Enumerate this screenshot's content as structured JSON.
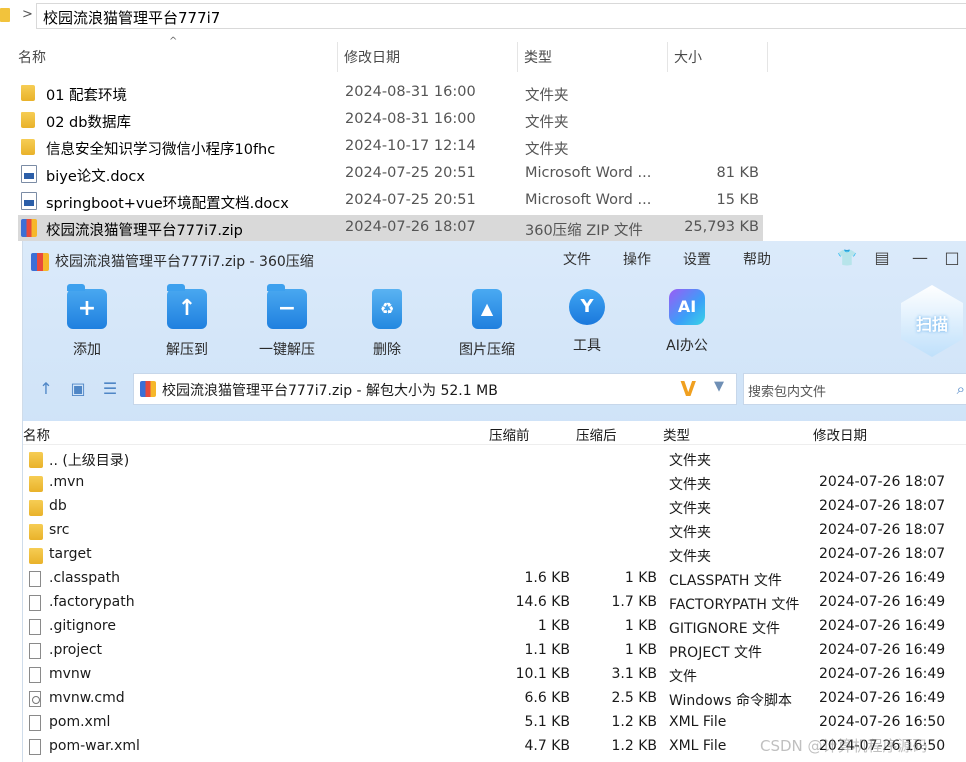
{
  "explorer": {
    "path": "校园流浪猫管理平台777i7",
    "columns": {
      "name": "名称",
      "date": "修改日期",
      "type": "类型",
      "size": "大小"
    },
    "rows": [
      {
        "name": "01 配套环境",
        "date": "2024-08-31 16:00",
        "type": "文件夹",
        "size": "",
        "icon": "folder-icon"
      },
      {
        "name": "02 db数据库",
        "date": "2024-08-31 16:00",
        "type": "文件夹",
        "size": "",
        "icon": "folder-icon"
      },
      {
        "name": "信息安全知识学习微信小程序10fhc",
        "date": "2024-10-17 12:14",
        "type": "文件夹",
        "size": "",
        "icon": "folder-icon"
      },
      {
        "name": "biye论文.docx",
        "date": "2024-07-25 20:51",
        "type": "Microsoft Word ...",
        "size": "81 KB",
        "icon": "word-doc-icon"
      },
      {
        "name": "springboot+vue环境配置文档.docx",
        "date": "2024-07-25 20:51",
        "type": "Microsoft Word ...",
        "size": "15 KB",
        "icon": "word-doc-icon"
      },
      {
        "name": "校园流浪猫管理平台777i7.zip",
        "date": "2024-07-26 18:07",
        "type": "360压缩 ZIP 文件",
        "size": "25,793 KB",
        "icon": "zip-icon"
      }
    ]
  },
  "zip": {
    "title": "校园流浪猫管理平台777i7.zip - 360压缩",
    "menu": [
      "文件",
      "操作",
      "设置",
      "帮助"
    ],
    "tools": [
      {
        "label": "添加",
        "icon": "add-icon"
      },
      {
        "label": "解压到",
        "icon": "extract-to-icon"
      },
      {
        "label": "一键解压",
        "icon": "one-click-extract-icon"
      },
      {
        "label": "删除",
        "icon": "delete-icon"
      },
      {
        "label": "图片压缩",
        "icon": "image-compress-icon"
      },
      {
        "label": "工具",
        "icon": "tools-icon"
      },
      {
        "label": "AI办公",
        "icon": "ai-office-icon"
      }
    ],
    "scan_label": "扫描",
    "path_text": "校园流浪猫管理平台777i7.zip - 解包大小为 52.1 MB",
    "search_placeholder": "搜索包内文件",
    "columns": {
      "name": "名称",
      "packed_before": "压缩前",
      "packed_after": "压缩后",
      "type": "类型",
      "date": "修改日期"
    },
    "rows": [
      {
        "name": ".. (上级目录)",
        "before": "",
        "after": "",
        "type": "文件夹",
        "date": "",
        "icon": "folder-icon"
      },
      {
        "name": ".mvn",
        "before": "",
        "after": "",
        "type": "文件夹",
        "date": "2024-07-26 18:07",
        "icon": "folder-icon"
      },
      {
        "name": "db",
        "before": "",
        "after": "",
        "type": "文件夹",
        "date": "2024-07-26 18:07",
        "icon": "folder-icon"
      },
      {
        "name": "src",
        "before": "",
        "after": "",
        "type": "文件夹",
        "date": "2024-07-26 18:07",
        "icon": "folder-icon"
      },
      {
        "name": "target",
        "before": "",
        "after": "",
        "type": "文件夹",
        "date": "2024-07-26 18:07",
        "icon": "folder-icon"
      },
      {
        "name": ".classpath",
        "before": "1.6 KB",
        "after": "1 KB",
        "type": "CLASSPATH 文件",
        "date": "2024-07-26 16:49",
        "icon": "file-icon"
      },
      {
        "name": ".factorypath",
        "before": "14.6 KB",
        "after": "1.7 KB",
        "type": "FACTORYPATH 文件",
        "date": "2024-07-26 16:49",
        "icon": "file-icon"
      },
      {
        "name": ".gitignore",
        "before": "1 KB",
        "after": "1 KB",
        "type": "GITIGNORE 文件",
        "date": "2024-07-26 16:49",
        "icon": "file-icon"
      },
      {
        "name": ".project",
        "before": "1.1 KB",
        "after": "1 KB",
        "type": "PROJECT 文件",
        "date": "2024-07-26 16:49",
        "icon": "file-icon"
      },
      {
        "name": "mvnw",
        "before": "10.1 KB",
        "after": "3.1 KB",
        "type": "文件",
        "date": "2024-07-26 16:49",
        "icon": "file-icon"
      },
      {
        "name": "mvnw.cmd",
        "before": "6.6 KB",
        "after": "2.5 KB",
        "type": "Windows 命令脚本",
        "date": "2024-07-26 16:49",
        "icon": "cmd-script-icon"
      },
      {
        "name": "pom.xml",
        "before": "5.1 KB",
        "after": "1.2 KB",
        "type": "XML File",
        "date": "2024-07-26 16:50",
        "icon": "file-icon"
      },
      {
        "name": "pom-war.xml",
        "before": "4.7 KB",
        "after": "1.2 KB",
        "type": "XML File",
        "date": "2024-07-26 16:50",
        "icon": "file-icon"
      }
    ]
  },
  "watermark": "CSDN @计算机程序源码"
}
